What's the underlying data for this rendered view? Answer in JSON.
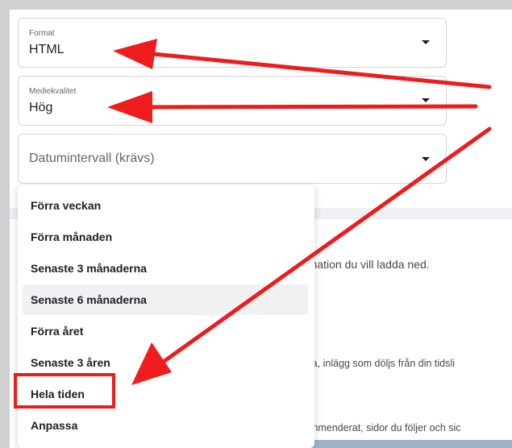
{
  "fields": {
    "format": {
      "label": "Format",
      "value": "HTML"
    },
    "media_quality": {
      "label": "Mediekvalitet",
      "value": "Hög"
    },
    "date_range": {
      "placeholder": "Datumintervall (krävs)"
    }
  },
  "background_text": {
    "line1": "rmation du vill ladda ned.",
    "line2": "ida, inlägg som döljs från din tidsli",
    "line3": "ommenderat, sidor du följer och sic"
  },
  "date_options": [
    {
      "label": "Förra veckan",
      "selected": false
    },
    {
      "label": "Förra månaden",
      "selected": false
    },
    {
      "label": "Senaste 3 månaderna",
      "selected": false
    },
    {
      "label": "Senaste 6 månaderna",
      "selected": true
    },
    {
      "label": "Förra året",
      "selected": false
    },
    {
      "label": "Senaste 3 åren",
      "selected": false
    },
    {
      "label": "Hela tiden",
      "selected": false,
      "annotated": true
    },
    {
      "label": "Anpassa",
      "selected": false
    }
  ],
  "annotation_color": "#ee1c1c",
  "icons": {
    "dropdown": "caret-down-icon"
  }
}
